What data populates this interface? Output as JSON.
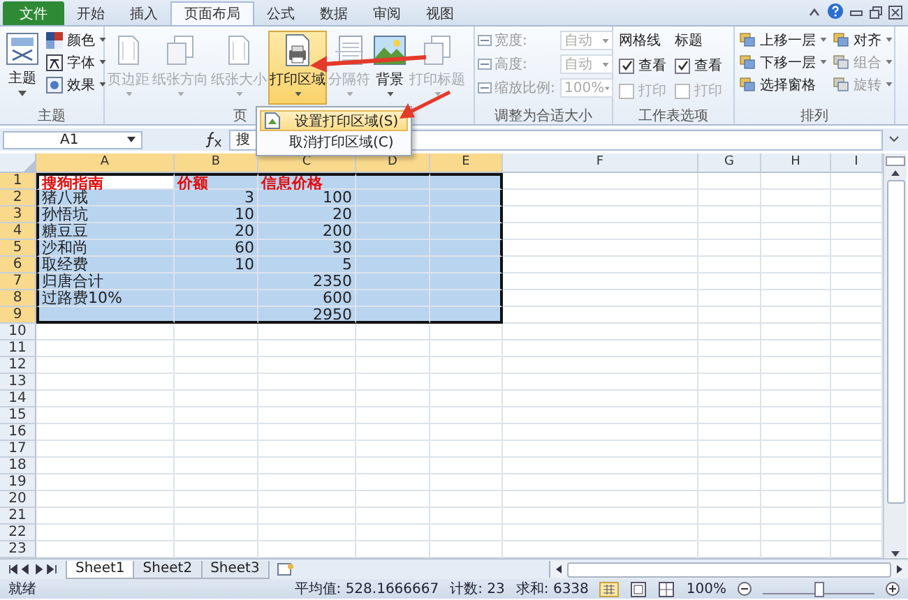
{
  "ribbon_tabs": [
    {
      "label": "文件",
      "kind": "file",
      "selected": false
    },
    {
      "label": "开始",
      "kind": "tab",
      "selected": false
    },
    {
      "label": "插入",
      "kind": "tab",
      "selected": false
    },
    {
      "label": "页面布局",
      "kind": "tab",
      "selected": true
    },
    {
      "label": "公式",
      "kind": "tab",
      "selected": false
    },
    {
      "label": "数据",
      "kind": "tab",
      "selected": false
    },
    {
      "label": "审阅",
      "kind": "tab",
      "selected": false
    },
    {
      "label": "视图",
      "kind": "tab",
      "selected": false
    }
  ],
  "theme_group": {
    "label": "主题",
    "main": "主题",
    "items": [
      "颜色",
      "字体",
      "效果"
    ]
  },
  "page_setup_group": {
    "label": "页",
    "buttons": [
      {
        "label": "页边距",
        "disabled": true,
        "pressed": false
      },
      {
        "label": "纸张方向",
        "disabled": true,
        "pressed": false
      },
      {
        "label": "纸张大小",
        "disabled": true,
        "pressed": false
      },
      {
        "label": "打印区域",
        "disabled": false,
        "pressed": true
      },
      {
        "label": "分隔符",
        "disabled": true,
        "pressed": false
      },
      {
        "label": "背景",
        "disabled": false,
        "pressed": false
      },
      {
        "label": "打印标题",
        "disabled": true,
        "pressed": false
      }
    ]
  },
  "scale_group": {
    "label": "调整为合适大小",
    "fields": [
      {
        "label": "宽度:",
        "value": "自动"
      },
      {
        "label": "高度:",
        "value": "自动"
      },
      {
        "label": "缩放比例:",
        "value": "100%"
      }
    ]
  },
  "sheet_options_group": {
    "label": "工作表选项",
    "columns": [
      {
        "title": "网格线",
        "options": [
          {
            "label": "查看",
            "checked": true,
            "disabled": false
          },
          {
            "label": "打印",
            "checked": false,
            "disabled": true
          }
        ]
      },
      {
        "title": "标题",
        "options": [
          {
            "label": "查看",
            "checked": true,
            "disabled": false
          },
          {
            "label": "打印",
            "checked": false,
            "disabled": true
          }
        ]
      }
    ]
  },
  "arrange_group": {
    "label": "排列",
    "buttons": [
      {
        "label": "上移一层",
        "disabled": false,
        "dropdown": true
      },
      {
        "label": "对齐",
        "disabled": false,
        "dropdown": true
      },
      {
        "label": "下移一层",
        "disabled": false,
        "dropdown": true
      },
      {
        "label": "组合",
        "disabled": true,
        "dropdown": true
      },
      {
        "label": "选择窗格",
        "disabled": false,
        "dropdown": false
      },
      {
        "label": "旋转",
        "disabled": true,
        "dropdown": true
      }
    ]
  },
  "formula_bar": {
    "name_box": "A1",
    "content": "搜"
  },
  "print_area_menu": {
    "items": [
      {
        "label": "设置打印区域(S)",
        "selected": true
      },
      {
        "label": "取消打印区域(C)",
        "selected": false
      }
    ]
  },
  "sheet": {
    "columns": [
      "A",
      "B",
      "C",
      "D",
      "E",
      "F",
      "G",
      "H",
      "I"
    ],
    "rows": [
      {
        "number": "1",
        "kind": "header",
        "selected": true,
        "cells": {
          "A": "搜狗指南",
          "B": "价额",
          "C": "信息价格"
        }
      },
      {
        "number": "2",
        "kind": "data",
        "selected": true,
        "cells": {
          "A": "猪八戒",
          "B": "3",
          "C": "100"
        }
      },
      {
        "number": "3",
        "kind": "data",
        "selected": true,
        "cells": {
          "A": "孙悟坑",
          "B": "10",
          "C": "20"
        }
      },
      {
        "number": "4",
        "kind": "data",
        "selected": true,
        "cells": {
          "A": "糖豆豆",
          "B": "20",
          "C": "200"
        }
      },
      {
        "number": "5",
        "kind": "data",
        "selected": true,
        "cells": {
          "A": "沙和尚",
          "B": "60",
          "C": "30"
        }
      },
      {
        "number": "6",
        "kind": "data",
        "selected": true,
        "cells": {
          "A": "取经费",
          "B": "10",
          "C": "5"
        }
      },
      {
        "number": "7",
        "kind": "data",
        "selected": true,
        "cells": {
          "A": "归唐合计",
          "C": "2350"
        }
      },
      {
        "number": "8",
        "kind": "data",
        "selected": true,
        "cells": {
          "A": "过路费10%",
          "C": "600"
        }
      },
      {
        "number": "9",
        "kind": "data",
        "selected": true,
        "cells": {
          "C": "2950"
        }
      },
      {
        "number": "10",
        "kind": "data",
        "selected": false,
        "cells": {}
      },
      {
        "number": "11",
        "kind": "data",
        "selected": false,
        "cells": {}
      },
      {
        "number": "12",
        "kind": "data",
        "selected": false,
        "cells": {}
      },
      {
        "number": "13",
        "kind": "data",
        "selected": false,
        "cells": {}
      },
      {
        "number": "14",
        "kind": "data",
        "selected": false,
        "cells": {}
      },
      {
        "number": "15",
        "kind": "data",
        "selected": false,
        "cells": {}
      },
      {
        "number": "16",
        "kind": "data",
        "selected": false,
        "cells": {}
      },
      {
        "number": "17",
        "kind": "data",
        "selected": false,
        "cells": {}
      },
      {
        "number": "18",
        "kind": "data",
        "selected": false,
        "cells": {}
      },
      {
        "number": "19",
        "kind": "data",
        "selected": false,
        "cells": {}
      },
      {
        "number": "20",
        "kind": "data",
        "selected": false,
        "cells": {}
      },
      {
        "number": "21",
        "kind": "data",
        "selected": false,
        "cells": {}
      },
      {
        "number": "22",
        "kind": "data",
        "selected": false,
        "cells": {}
      },
      {
        "number": "23",
        "kind": "data",
        "selected": false,
        "cells": {}
      }
    ]
  },
  "sheet_tabs": [
    {
      "label": "Sheet1",
      "selected": true
    },
    {
      "label": "Sheet2",
      "selected": false
    },
    {
      "label": "Sheet3",
      "selected": false
    }
  ],
  "status_bar": {
    "state": "就绪",
    "average": "平均值: 528.1666667",
    "count": "计数: 23",
    "sum": "求和: 6338",
    "zoom": "100%",
    "zoom_slider": {
      "level": 0.5
    }
  }
}
